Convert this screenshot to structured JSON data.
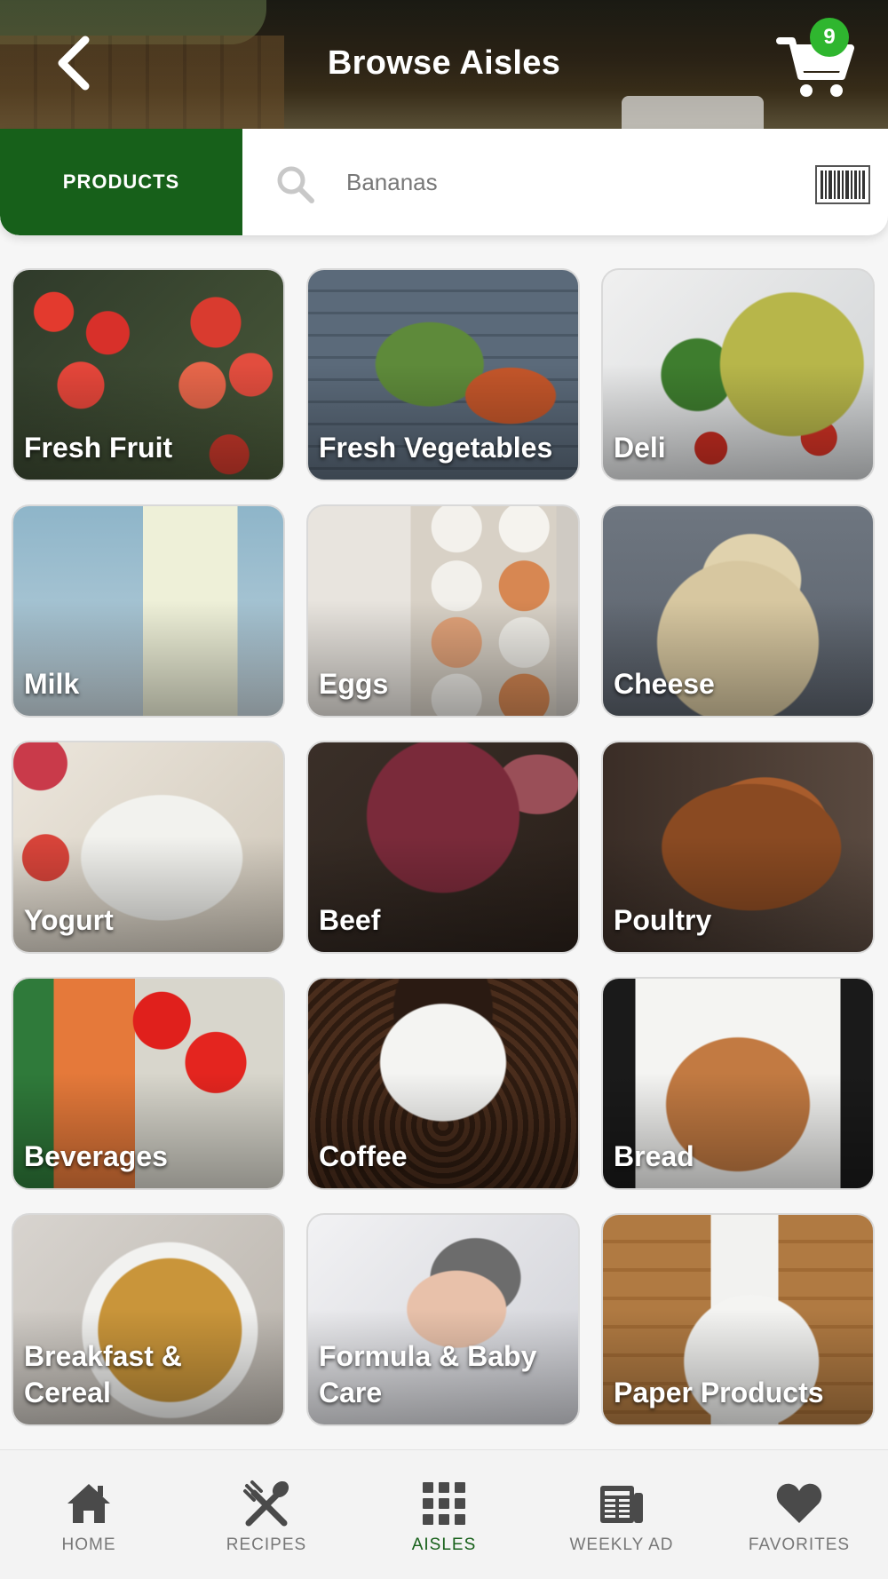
{
  "header": {
    "title": "Browse Aisles",
    "cart_count": "9"
  },
  "search": {
    "tab_label": "PRODUCTS",
    "placeholder": "Bananas"
  },
  "aisles": [
    {
      "label": "Fresh Fruit"
    },
    {
      "label": "Fresh Vegetables"
    },
    {
      "label": "Deli"
    },
    {
      "label": "Milk"
    },
    {
      "label": "Eggs"
    },
    {
      "label": "Cheese"
    },
    {
      "label": "Yogurt"
    },
    {
      "label": "Beef"
    },
    {
      "label": "Poultry"
    },
    {
      "label": "Beverages"
    },
    {
      "label": "Coffee"
    },
    {
      "label": "Bread"
    },
    {
      "label": "Breakfast & Cereal"
    },
    {
      "label": "Formula & Baby Care"
    },
    {
      "label": "Paper Products"
    }
  ],
  "bottom_nav": {
    "items": [
      {
        "label": "HOME",
        "icon": "home-icon"
      },
      {
        "label": "RECIPES",
        "icon": "utensils-icon"
      },
      {
        "label": "AISLES",
        "icon": "grid-icon"
      },
      {
        "label": "WEEKLY AD",
        "icon": "newspaper-icon"
      },
      {
        "label": "FAVORITES",
        "icon": "heart-icon"
      }
    ],
    "active": "AISLES"
  },
  "colors": {
    "brand_green": "#17601a",
    "badge_green": "#2fb62f"
  }
}
